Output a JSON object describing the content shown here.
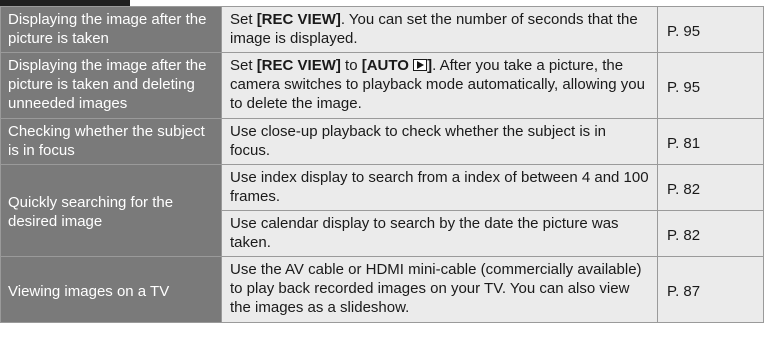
{
  "rows": [
    {
      "label": "Displaying the image after the picture is taken",
      "desc_pre": "Set ",
      "desc_b1": "[REC VIEW]",
      "desc_post": ". You can set the number of seconds that the image is displayed.",
      "page": "P. 95"
    },
    {
      "label": "Displaying the image after the picture is taken and deleting unneeded images",
      "desc_pre": "Set ",
      "desc_b1": "[REC VIEW]",
      "desc_mid": " to ",
      "desc_b2": "[AUTO ",
      "desc_icon": "play-icon",
      "desc_b3": "]",
      "desc_post": ". After you take a picture, the camera switches to playback mode automatically, allowing you to delete the image.",
      "page": "P. 95"
    },
    {
      "label": "Checking whether the subject is in focus",
      "desc": "Use close-up playback to check whether the subject is in focus.",
      "page": "P. 81"
    },
    {
      "label": "Quickly searching for the desired image",
      "sub": [
        {
          "desc": "Use index display to search from a index of between 4 and 100 frames.",
          "page": "P. 82"
        },
        {
          "desc": "Use calendar display to search by the date the picture was taken.",
          "page": "P. 82"
        }
      ]
    },
    {
      "label": "Viewing images on a TV",
      "desc": "Use the AV cable or HDMI mini-cable (commercially available) to play back recorded images on your TV. You can also view the images as a slideshow.",
      "page": "P. 87"
    }
  ]
}
